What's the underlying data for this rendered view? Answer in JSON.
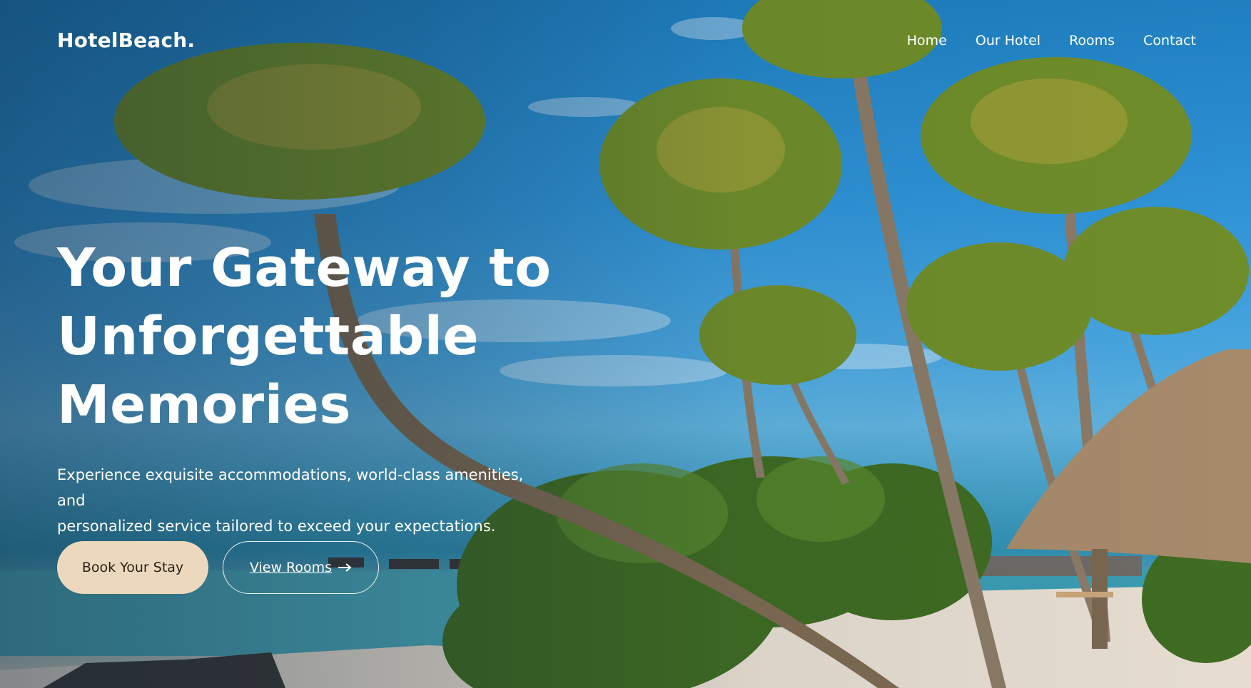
{
  "brand": {
    "logo": "HotelBeach."
  },
  "nav": {
    "items": [
      {
        "label": "Home"
      },
      {
        "label": "Our Hotel"
      },
      {
        "label": "Rooms"
      },
      {
        "label": "Contact"
      }
    ]
  },
  "hero": {
    "title_lines": [
      "Your Gateway to",
      "Unforgettable",
      "Memories"
    ],
    "subtitle_lines": [
      "Experience exquisite accommodations, world-class amenities, and",
      "personalized service tailored to exceed your expectations."
    ],
    "primary_button": "Book Your Stay",
    "secondary_button": "View Rooms",
    "secondary_icon": "arrow-right-icon"
  },
  "colors": {
    "primary_button_bg": "#ecd9bd",
    "text": "#ffffff",
    "sky": "#2f93d6"
  }
}
